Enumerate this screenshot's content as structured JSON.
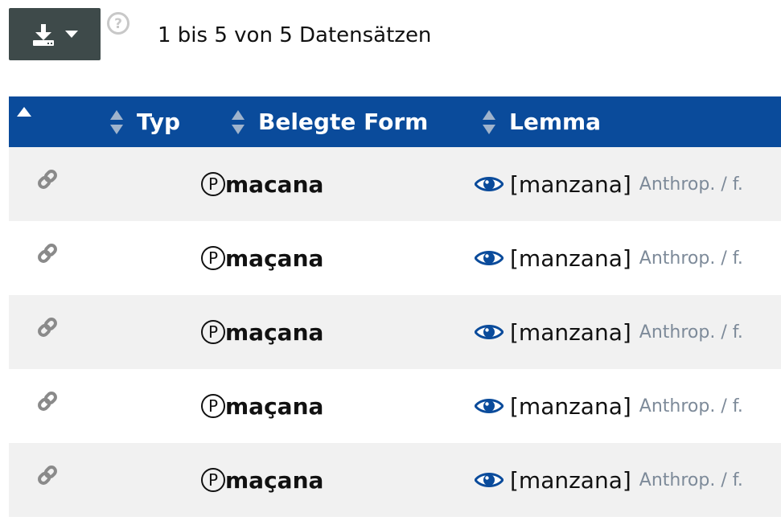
{
  "toolbar": {
    "export_icon": "download-icon",
    "dropdown_icon": "caret-down-icon",
    "help_icon": "question-circle-icon",
    "record_info": "1 bis 5 von 5 Datensätzen",
    "export_bg": "#3e4a4a"
  },
  "table": {
    "header_bg": "#0a4b9b",
    "columns": [
      {
        "label": "",
        "sort_icon": "sort-up-icon"
      },
      {
        "label": "Typ",
        "sort_icon": "sort-both-icon"
      },
      {
        "label": "Belegte Form",
        "sort_icon": "sort-both-icon"
      },
      {
        "label": "Lemma",
        "sort_icon": "sort-both-icon"
      }
    ],
    "rows": [
      {
        "link_icon": "link-icon",
        "typ": "P",
        "form": "macana",
        "lemma": "[manzana]",
        "meta": "Anthrop. / f."
      },
      {
        "link_icon": "link-icon",
        "typ": "P",
        "form": "maçana",
        "lemma": "[manzana]",
        "meta": "Anthrop. / f."
      },
      {
        "link_icon": "link-icon",
        "typ": "P",
        "form": "maçana",
        "lemma": "[manzana]",
        "meta": "Anthrop. / f."
      },
      {
        "link_icon": "link-icon",
        "typ": "P",
        "form": "maçana",
        "lemma": "[manzana]",
        "meta": "Anthrop. / f."
      },
      {
        "link_icon": "link-icon",
        "typ": "P",
        "form": "maçana",
        "lemma": "[manzana]",
        "meta": "Anthrop. / f."
      }
    ]
  }
}
